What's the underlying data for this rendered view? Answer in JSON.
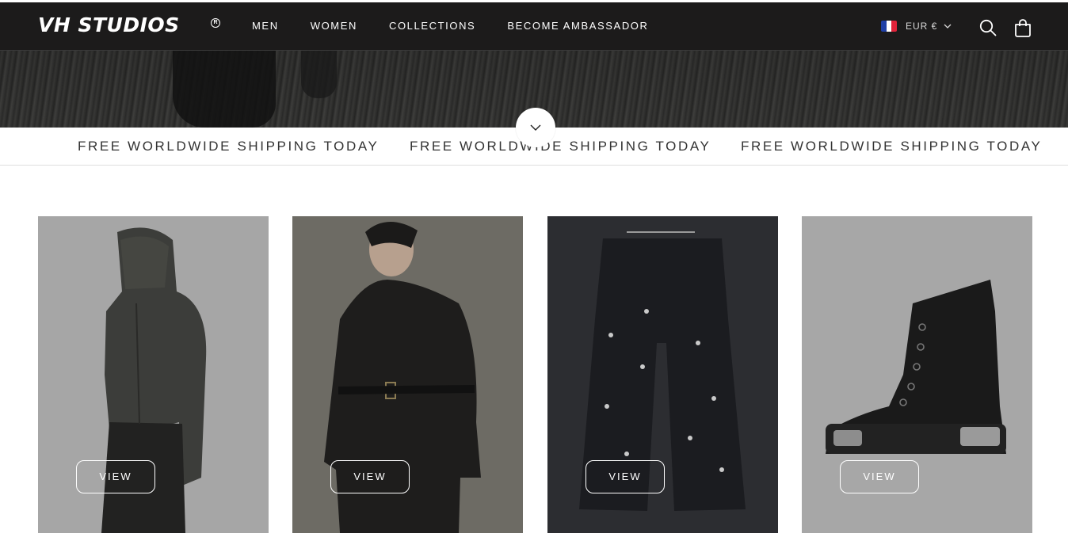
{
  "header": {
    "logo": "VH STUDIOS",
    "logo_mark": "R",
    "nav": [
      "MEN",
      "WOMEN",
      "COLLECTIONS",
      "BECOME AMBASSADOR"
    ],
    "currency": "EUR €",
    "icons": [
      "france-flag-icon",
      "chevron-down-icon",
      "search-icon",
      "shopping-bag-icon"
    ]
  },
  "hero": {
    "scroll_icon": "chevron-down-icon"
  },
  "announcement": {
    "items": [
      "FREE WORLDWIDE SHIPPING TODAY",
      "FREE WORLDWIDE SHIPPING TODAY",
      "FREE WORLDWIDE SHIPPING TODAY"
    ]
  },
  "products": [
    {
      "button": "VIEW"
    },
    {
      "button": "VIEW"
    },
    {
      "button": "VIEW"
    },
    {
      "button": "VIEW"
    }
  ],
  "colors": {
    "header_bg": "#1c1b1b",
    "accent": "#ffffff",
    "text": "#333333"
  }
}
